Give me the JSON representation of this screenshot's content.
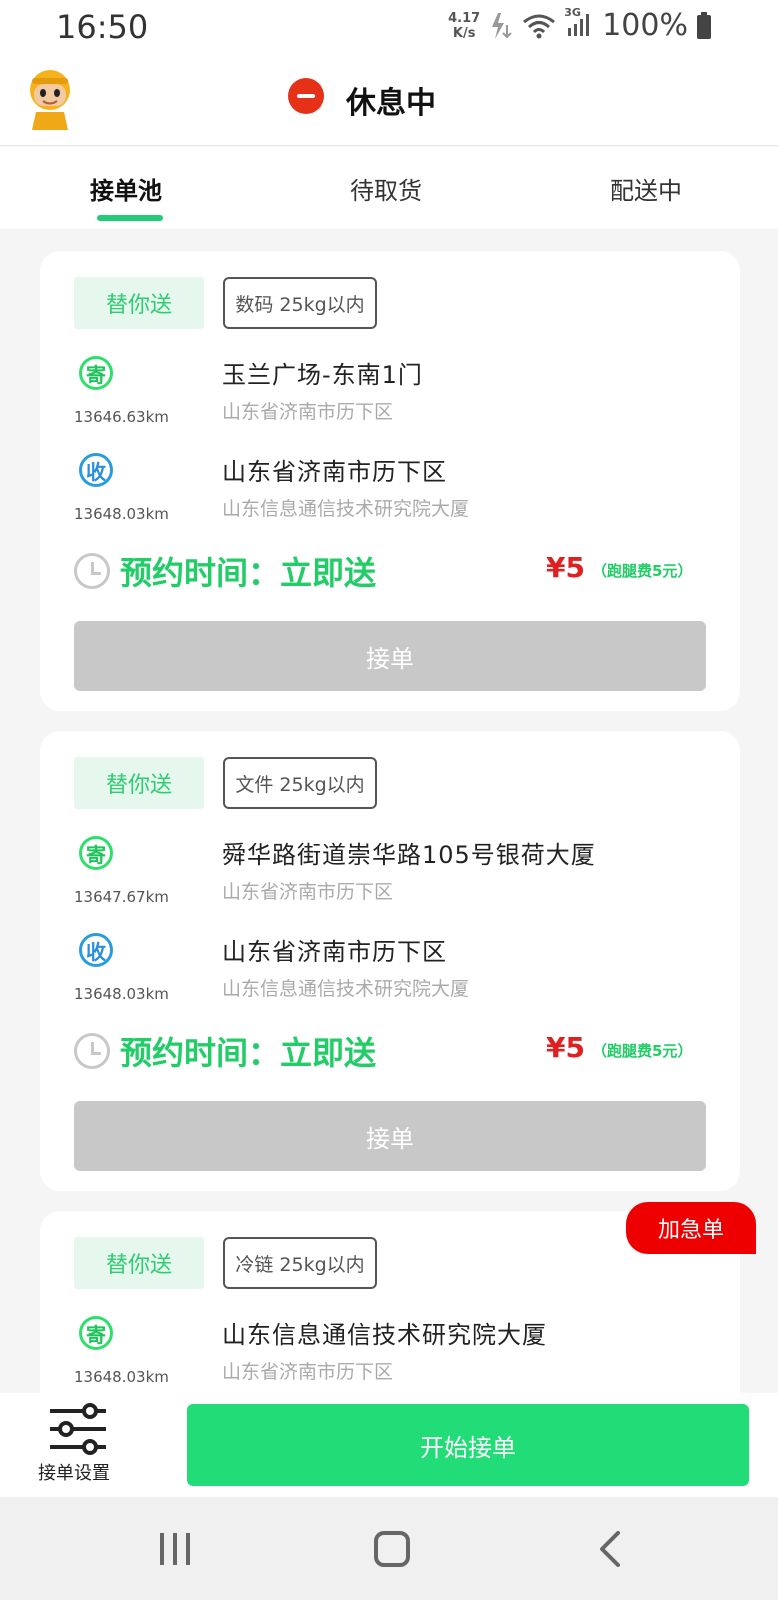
{
  "status_bar": {
    "time": "16:50",
    "speed_value": "4.17",
    "speed_unit": "K/s",
    "network": "3G",
    "battery": "100%"
  },
  "header": {
    "status_text": "休息中",
    "status_color": "#e53118"
  },
  "tabs": [
    "接单池",
    "待取货",
    "配送中"
  ],
  "active_tab": 0,
  "orders": [
    {
      "type": "替你送",
      "category": "数码 25kg以内",
      "pickup": {
        "icon": "寄",
        "distance": "13646.63km",
        "address": "玉兰广场-东南1门",
        "region": "山东省济南市历下区"
      },
      "delivery": {
        "icon": "收",
        "distance": "13648.03km",
        "address": "山东省济南市历下区",
        "region": "山东信息通信技术研究院大厦"
      },
      "time": "预约时间：立即送",
      "price": "¥5",
      "fee": "（跑腿费5元）",
      "button": "接单"
    },
    {
      "type": "替你送",
      "category": "文件 25kg以内",
      "pickup": {
        "icon": "寄",
        "distance": "13647.67km",
        "address": "舜华路街道崇华路105号银荷大厦",
        "region": "山东省济南市历下区"
      },
      "delivery": {
        "icon": "收",
        "distance": "13648.03km",
        "address": "山东省济南市历下区",
        "region": "山东信息通信技术研究院大厦"
      },
      "time": "预约时间：立即送",
      "price": "¥5",
      "fee": "（跑腿费5元）",
      "button": "接单"
    },
    {
      "urgent_label": "加急单",
      "type": "替你送",
      "category": "冷链 25kg以内",
      "pickup": {
        "icon": "寄",
        "distance": "13648.03km",
        "address": "山东信息通信技术研究院大厦",
        "region": "山东省济南市历下区"
      }
    }
  ],
  "bottom": {
    "settings_label": "接单设置",
    "start_button": "开始接单"
  },
  "colors": {
    "accent_green": "#22dd77",
    "price_red": "#e02020",
    "urgent_red": "#ee0000"
  }
}
